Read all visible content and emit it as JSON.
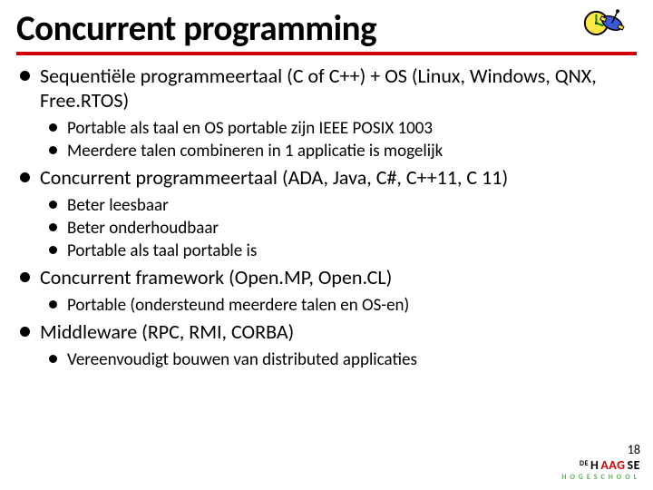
{
  "title": "Concurrent programming",
  "bullets": [
    {
      "text": "Sequentiële programmeertaal (C of C++) + OS (Linux, Windows, QNX, Free.RTOS)",
      "sub": [
        "Portable als taal en OS portable zijn IEEE POSIX 1003",
        "Meerdere talen combineren in 1 applicatie is mogelijk"
      ]
    },
    {
      "text": "Concurrent programmeertaal (ADA, Java, C#, C++11, C 11)",
      "sub": [
        "Beter leesbaar",
        "Beter onderhoudbaar",
        "Portable als taal portable is"
      ]
    },
    {
      "text": "Concurrent framework (Open.MP, Open.CL)",
      "sub": [
        "Portable (ondersteund meerdere talen en OS-en)"
      ]
    },
    {
      "text": "Middleware (RPC, RMI, CORBA)",
      "sub": [
        "Vereenvoudigt bouwen van distributed applicaties"
      ]
    }
  ],
  "page_number": "18",
  "logo": {
    "de": "DE",
    "h": "H",
    "aag": "AAG",
    "se": "SE",
    "sub": "HOGESCHOOL"
  }
}
